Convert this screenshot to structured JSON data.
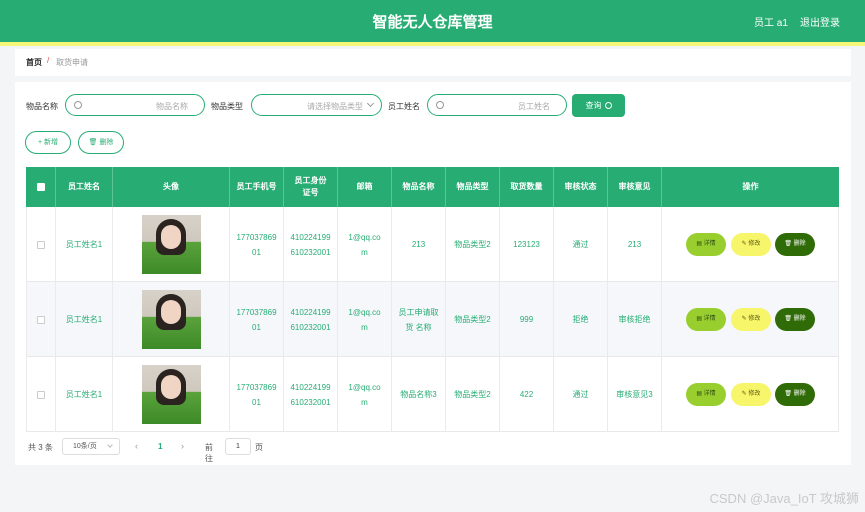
{
  "header": {
    "title": "智能无人仓库管理",
    "user": "员工 a1",
    "logout": "退出登录",
    "accent_color": "#27ad74",
    "strip_color": "#f6f878"
  },
  "breadcrumb": {
    "home": "首页",
    "separator": "/",
    "current": "取货申请"
  },
  "search": {
    "item_name_label": "物品名称",
    "item_name_placeholder": "物品名称",
    "item_type_label": "物品类型",
    "item_type_placeholder": "请选择物品类型",
    "staff_name_label": "员工姓名",
    "staff_name_placeholder": "员工姓名",
    "query_button": "查询"
  },
  "toolbar": {
    "add": "+ 新增",
    "delete": "🗑 删除"
  },
  "table": {
    "headers": [
      "员工姓名",
      "头像",
      "员工手机号",
      "员工身份证号",
      "邮箱",
      "物品名称",
      "物品类型",
      "取货数量",
      "审核状态",
      "审核意见",
      "操作"
    ],
    "rows": [
      {
        "name": "员工姓名1",
        "phone": "17703786901",
        "id_card": "410224199610232001",
        "email": "1@qq.com",
        "item": "213",
        "type": "物品类型2",
        "qty": "123123",
        "status": "通过",
        "opinion": "213"
      },
      {
        "name": "员工姓名1",
        "phone": "17703786901",
        "id_card": "410224199610232001",
        "email": "1@qq.com",
        "item": "员工申请取货 名称",
        "type": "物品类型2",
        "qty": "999",
        "status": "拒绝",
        "opinion": "审核拒绝"
      },
      {
        "name": "员工姓名1",
        "phone": "17703786901",
        "id_card": "410224199610232001",
        "email": "1@qq.com",
        "item": "物品名称3",
        "type": "物品类型2",
        "qty": "422",
        "status": "通过",
        "opinion": "审核意见3"
      }
    ],
    "actions": {
      "detail": "详情",
      "edit": "修改",
      "delete": "删除"
    }
  },
  "pagination": {
    "total": "共 3 条",
    "page_size": "10条/页",
    "prev": "‹",
    "current_page": "1",
    "next": "›",
    "goto_label": "前往",
    "goto_value": "1",
    "unit": "页"
  },
  "watermark": "CSDN @Java_IoT 攻城狮"
}
